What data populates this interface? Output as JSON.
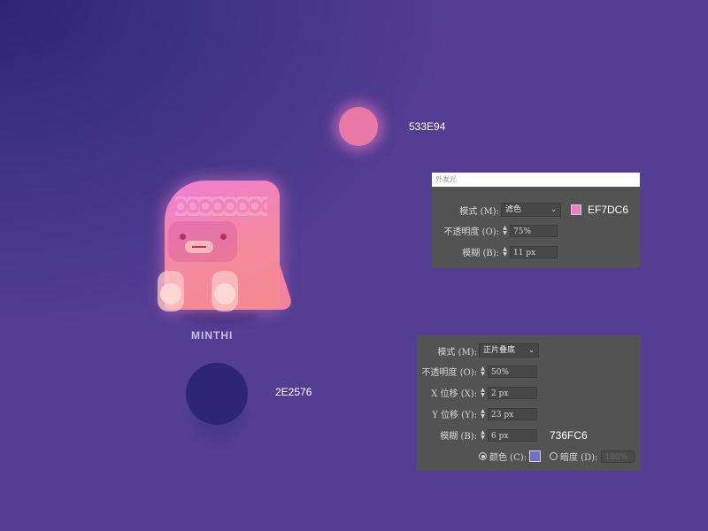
{
  "top_swatch": {
    "hex": "533E94",
    "circle_color": "#E879A6"
  },
  "bottom_swatch": {
    "hex": "2E2576",
    "circle_color": "#2E2576"
  },
  "brand": {
    "name": "MINTHI"
  },
  "outer_glow_panel": {
    "title": "外发光",
    "mode_label": "模式 (M):",
    "mode_value": "滤色",
    "color_hex": "EF7DC6",
    "color_swatch": "#EF7DC6",
    "opacity_label": "不透明度 (O):",
    "opacity_value": "75%",
    "blur_label": "模糊 (B):",
    "blur_value": "11 px"
  },
  "drop_shadow_panel": {
    "mode_label": "模式 (M):",
    "mode_value": "正片叠底",
    "opacity_label": "不透明度 (O):",
    "opacity_value": "50%",
    "x_offset_label": "X 位移 (X):",
    "x_offset_value": "2 px",
    "y_offset_label": "Y 位移 (Y):",
    "y_offset_value": "23 px",
    "blur_label": "模糊 (B):",
    "blur_value": "6 px",
    "color_hex": "736FC6",
    "color_radio_label": "颜色 (C):",
    "color_swatch": "#736FC6",
    "darkness_radio_label": "暗度 (D):",
    "darkness_value": "100%"
  },
  "icons": {
    "stepper": "stepper-arrows-icon",
    "select_caret": "chevron-down-icon"
  }
}
